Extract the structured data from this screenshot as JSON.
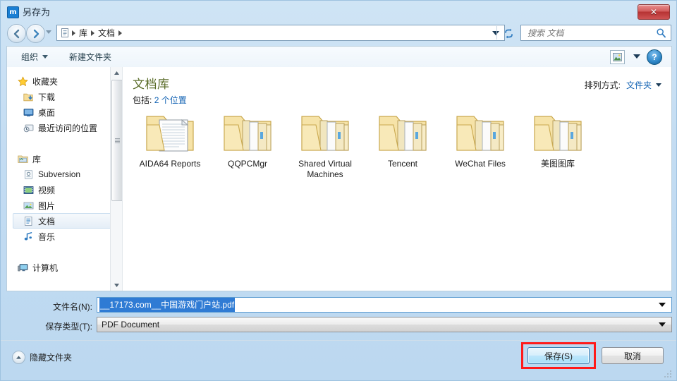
{
  "window": {
    "title": "另存为",
    "icon": "maxthon-app-icon",
    "icon_glyph": "m",
    "close_label": "✕"
  },
  "nav": {
    "back_icon": "back-arrow-icon",
    "forward_icon": "forward-arrow-icon",
    "history_icon": "history-dropdown-icon",
    "breadcrumb_icon": "library-icon",
    "breadcrumb": [
      "库",
      "文档"
    ],
    "address_dropdown_icon": "chevron-down-icon",
    "refresh_icon": "refresh-icon",
    "search": {
      "placeholder": "搜索 文档",
      "value": "",
      "icon": "search-icon"
    }
  },
  "toolbar": {
    "organize_label": "组织",
    "new_folder_label": "新建文件夹",
    "view_icon": "view-options-icon",
    "view_caret_icon": "chevron-down-icon",
    "help_icon": "help-icon",
    "help_glyph": "?"
  },
  "sidebar": {
    "groups": [
      {
        "header": {
          "label": "收藏夹",
          "icon": "star-icon"
        },
        "items": [
          {
            "label": "下载",
            "icon": "downloads-folder-icon",
            "selected": false
          },
          {
            "label": "桌面",
            "icon": "desktop-icon",
            "selected": false
          },
          {
            "label": "最近访问的位置",
            "icon": "recent-places-icon",
            "selected": false
          }
        ]
      },
      {
        "header": {
          "label": "库",
          "icon": "library-folder-icon"
        },
        "items": [
          {
            "label": "Subversion",
            "icon": "subversion-icon",
            "selected": false
          },
          {
            "label": "视频",
            "icon": "video-icon",
            "selected": false
          },
          {
            "label": "图片",
            "icon": "pictures-icon",
            "selected": false
          },
          {
            "label": "文档",
            "icon": "documents-icon",
            "selected": true
          },
          {
            "label": "音乐",
            "icon": "music-icon",
            "selected": false
          }
        ]
      },
      {
        "header": {
          "label": "计算机",
          "icon": "computer-icon"
        },
        "items": []
      }
    ],
    "scrollbar": {
      "up_icon": "scroll-up-icon",
      "down_icon": "scroll-down-icon"
    }
  },
  "content": {
    "library_title": "文档库",
    "includes_prefix": "包括:",
    "includes_link": "2 个位置",
    "arrange_label": "排列方式:",
    "arrange_value": "文件夹",
    "arrange_caret_icon": "chevron-down-icon",
    "folders": [
      {
        "name": "AIDA64 Reports",
        "icon": "folder-with-document-icon"
      },
      {
        "name": "QQPCMgr",
        "icon": "folder-with-files-icon"
      },
      {
        "name": "Shared Virtual Machines",
        "icon": "folder-with-files-icon"
      },
      {
        "name": "Tencent",
        "icon": "folder-with-files-icon"
      },
      {
        "name": "WeChat Files",
        "icon": "folder-with-files-icon"
      },
      {
        "name": "美图图库",
        "icon": "folder-with-files-icon"
      }
    ]
  },
  "form": {
    "filename_label": "文件名(N):",
    "filename_value": "__17173.com__中国游戏门户站.pdf",
    "filename_caret_icon": "chevron-down-icon",
    "filetype_label": "保存类型(T):",
    "filetype_value": "PDF Document",
    "filetype_caret_icon": "chevron-down-icon"
  },
  "footer": {
    "hide_folders_label": "隐藏文件夹",
    "hide_folders_icon": "chevron-up-circle-icon",
    "save_label": "保存(S)",
    "cancel_label": "取消",
    "highlight_color": "#ff1a1a"
  }
}
